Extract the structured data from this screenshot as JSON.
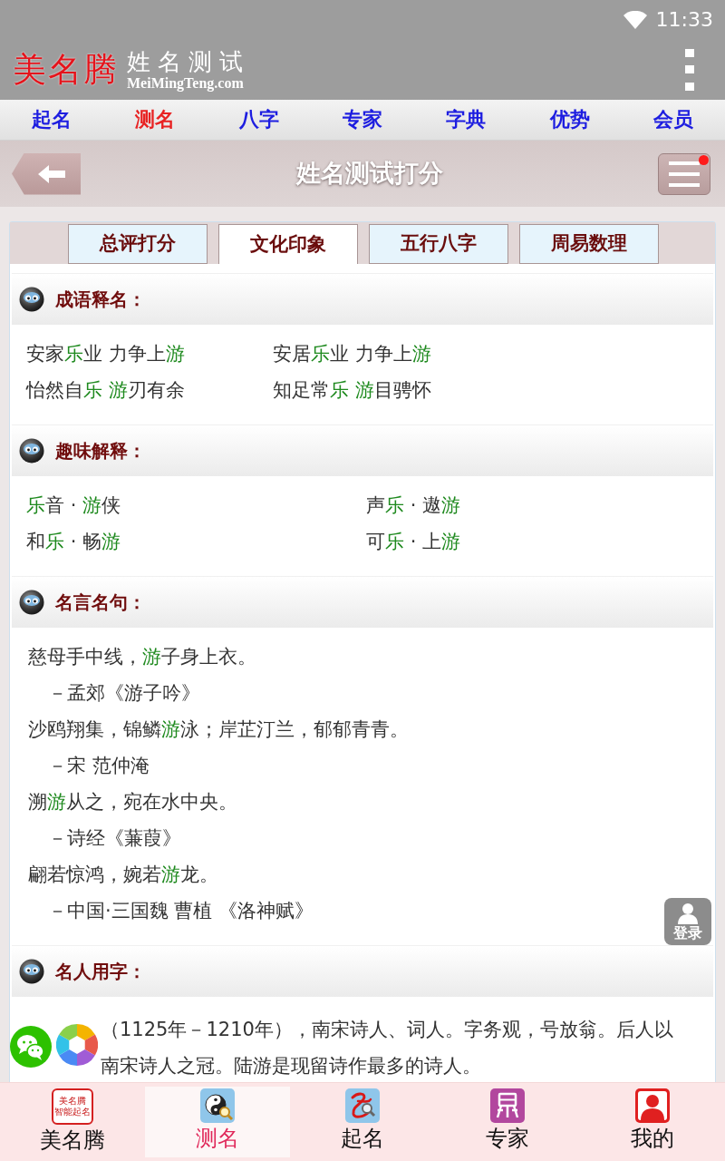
{
  "status_bar": {
    "time": "11:33"
  },
  "header": {
    "logo": "美名腾",
    "title": "姓名测试",
    "domain": "MeiMingTeng.com"
  },
  "top_nav": [
    {
      "label": "起名",
      "selected": false
    },
    {
      "label": "测名",
      "selected": true
    },
    {
      "label": "八字",
      "selected": false
    },
    {
      "label": "专家",
      "selected": false
    },
    {
      "label": "字典",
      "selected": false
    },
    {
      "label": "优势",
      "selected": false
    },
    {
      "label": "会员",
      "selected": false
    }
  ],
  "title_bar": {
    "title": "姓名测试打分",
    "notification": true
  },
  "tabs": [
    {
      "label": "总评打分",
      "selected": false
    },
    {
      "label": "文化印象",
      "selected": true
    },
    {
      "label": "五行八字",
      "selected": false
    },
    {
      "label": "周易数理",
      "selected": false
    }
  ],
  "sections": [
    {
      "kind": "idioms",
      "title": "成语释名：",
      "items": [
        [
          {
            "text": "安家",
            "highlight": false
          },
          {
            "text": "乐",
            "highlight": true
          },
          {
            "text": "业 力争上",
            "highlight": false
          },
          {
            "text": "游",
            "highlight": true
          }
        ],
        [
          {
            "text": "安居",
            "highlight": false
          },
          {
            "text": "乐",
            "highlight": true
          },
          {
            "text": "业 力争上",
            "highlight": false
          },
          {
            "text": "游",
            "highlight": true
          }
        ],
        [
          {
            "text": "怡然自",
            "highlight": false
          },
          {
            "text": "乐",
            "highlight": true
          },
          {
            "text": " 游",
            "highlight": true
          },
          {
            "text": "刃有余",
            "highlight": false
          }
        ],
        [
          {
            "text": "知足常",
            "highlight": false
          },
          {
            "text": "乐",
            "highlight": true
          },
          {
            "text": " 游",
            "highlight": true
          },
          {
            "text": "目骋怀",
            "highlight": false
          }
        ]
      ]
    },
    {
      "kind": "pairs",
      "title": "趣味解释：",
      "items": [
        [
          {
            "text": "乐",
            "highlight": true
          },
          {
            "text": "音 · ",
            "highlight": false
          },
          {
            "text": "游",
            "highlight": true
          },
          {
            "text": "侠",
            "highlight": false
          }
        ],
        [
          {
            "text": "声",
            "highlight": false
          },
          {
            "text": "乐",
            "highlight": true
          },
          {
            "text": " · 遨",
            "highlight": false
          },
          {
            "text": "游",
            "highlight": true
          }
        ],
        [
          {
            "text": "和",
            "highlight": false
          },
          {
            "text": "乐",
            "highlight": true
          },
          {
            "text": " · 畅",
            "highlight": false
          },
          {
            "text": "游",
            "highlight": true
          }
        ],
        [
          {
            "text": "可",
            "highlight": false
          },
          {
            "text": "乐",
            "highlight": true
          },
          {
            "text": " · 上",
            "highlight": false
          },
          {
            "text": "游",
            "highlight": true
          }
        ]
      ]
    },
    {
      "kind": "quotes",
      "title": "名言名句：",
      "items": [
        {
          "kind": "quote",
          "parts": [
            {
              "text": "慈母手中线，",
              "highlight": false
            },
            {
              "text": "游",
              "highlight": true
            },
            {
              "text": "子身上衣。",
              "highlight": false
            }
          ]
        },
        {
          "kind": "source",
          "parts": [
            {
              "text": "－孟郊《游子吟》",
              "highlight": false
            }
          ]
        },
        {
          "kind": "quote",
          "parts": [
            {
              "text": "沙鸥翔集，锦鳞",
              "highlight": false
            },
            {
              "text": "游",
              "highlight": true
            },
            {
              "text": "泳；岸芷汀兰，郁郁青青。",
              "highlight": false
            }
          ]
        },
        {
          "kind": "source",
          "parts": [
            {
              "text": "－宋 范仲淹",
              "highlight": false
            }
          ]
        },
        {
          "kind": "quote",
          "parts": [
            {
              "text": "溯",
              "highlight": false
            },
            {
              "text": "游",
              "highlight": true
            },
            {
              "text": "从之，宛在水中央。",
              "highlight": false
            }
          ]
        },
        {
          "kind": "source",
          "parts": [
            {
              "text": "－诗经《蒹葭》",
              "highlight": false
            }
          ]
        },
        {
          "kind": "quote",
          "parts": [
            {
              "text": "翩若惊鸿，婉若",
              "highlight": false
            },
            {
              "text": "游",
              "highlight": true
            },
            {
              "text": "龙。",
              "highlight": false
            }
          ]
        },
        {
          "kind": "source",
          "parts": [
            {
              "text": "－中国·三国魏 曹植 《洛神赋》",
              "highlight": false
            }
          ]
        }
      ]
    },
    {
      "kind": "paragraph",
      "title": "名人用字：",
      "items": [
        [
          {
            "text": "（1125年－1210年），南宋诗人、词人。字务观，号放翁。后人以",
            "highlight": false
          }
        ],
        [
          {
            "text": "南宋诗人之冠。陆游是现留诗作最多的诗人。",
            "highlight": false
          }
        ]
      ]
    }
  ],
  "login_button": {
    "label": "登录"
  },
  "bottom_nav": [
    {
      "label": "美名腾",
      "selected": false,
      "icon_text": [
        "美名腾",
        "智能起名"
      ]
    },
    {
      "label": "测名",
      "selected": true
    },
    {
      "label": "起名",
      "selected": false
    },
    {
      "label": "专家",
      "selected": false
    },
    {
      "label": "我的",
      "selected": false
    }
  ]
}
